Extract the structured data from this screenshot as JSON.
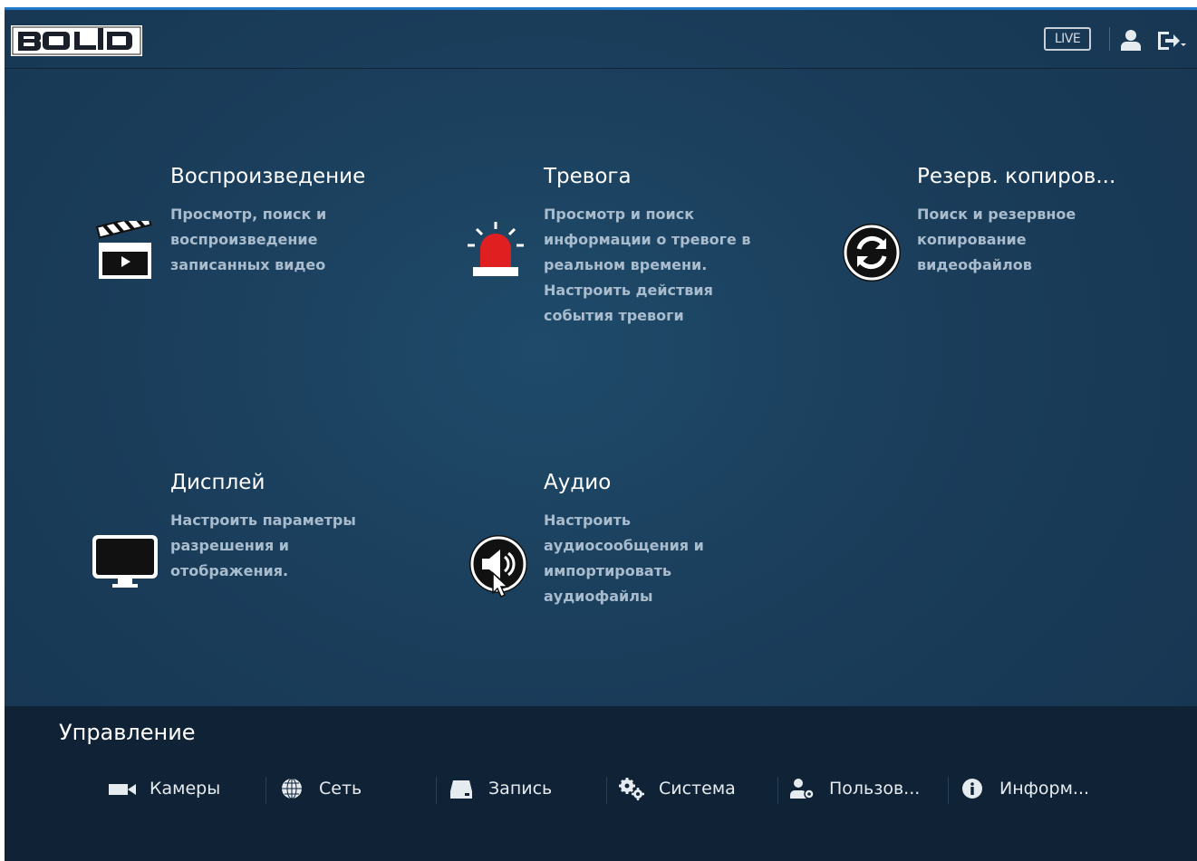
{
  "header": {
    "logo_text": "BOLID",
    "live_label": "LIVE",
    "icons": [
      "user-icon",
      "logout-icon"
    ]
  },
  "tiles": [
    {
      "title": "Воспроизведение",
      "description": "Просмотр, поиск и\nвоспроизведение\nзаписанных видео",
      "icon": "clapperboard-icon"
    },
    {
      "title": "Тревога",
      "description": "Просмотр и поиск\nинформации о тревоге в\nреальном времени.\nНастроить действия\nсобытия тревоги",
      "icon": "alarm-siren-icon"
    },
    {
      "title": "Резерв. копиров...",
      "description": "Поиск и резервное\nкопирование\nвидеофайлов",
      "icon": "backup-sync-icon"
    },
    {
      "title": "Дисплей",
      "description": "Настроить параметры\nразрешения и\nотображения.",
      "icon": "monitor-icon"
    },
    {
      "title": "Аудио",
      "description": "Настроить\nаудиосообщения и\nимпортировать\nаудиофайлы",
      "icon": "speaker-icon"
    }
  ],
  "management": {
    "title": "Управление",
    "items": [
      {
        "label": "Камеры",
        "icon": "camera-icon"
      },
      {
        "label": "Сеть",
        "icon": "globe-icon"
      },
      {
        "label": "Запись",
        "icon": "hdd-icon"
      },
      {
        "label": "Система",
        "icon": "gears-icon"
      },
      {
        "label": "Пользов...",
        "icon": "user-settings-icon"
      },
      {
        "label": "Информ...",
        "icon": "info-icon"
      }
    ]
  },
  "colors": {
    "background": "#1a3d5a",
    "management_bar": "#0f2236",
    "accent_top_line": "#1f78c8",
    "alarm_red": "#e02020",
    "description_text": "#a9bccd"
  }
}
